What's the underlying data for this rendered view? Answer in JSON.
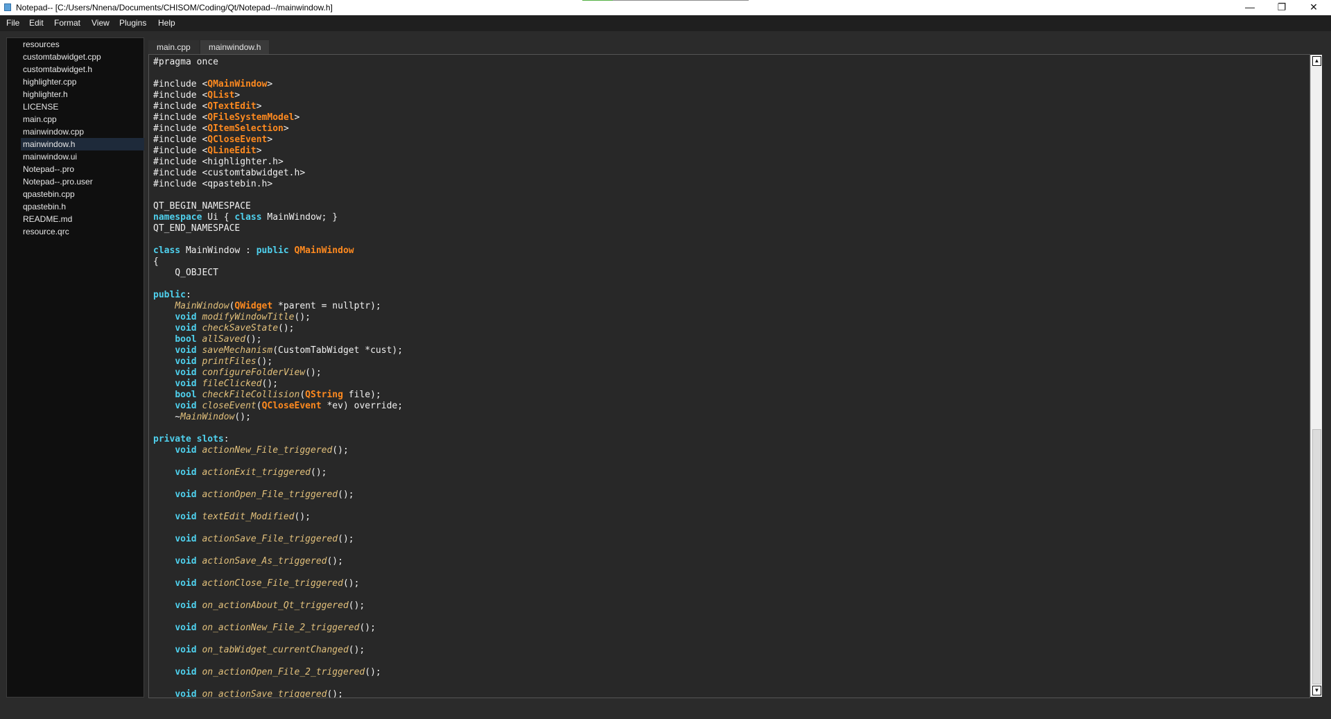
{
  "window": {
    "title": "Notepad-- [C:/Users/Nnena/Documents/CHISOM/Coding/Qt/Notepad--/mainwindow.h]",
    "minimize_label": "—",
    "restore_label": "❐",
    "close_label": "✕"
  },
  "menu": [
    "File",
    "Edit",
    "Format",
    "View",
    "Plugins",
    "Help"
  ],
  "files": [
    "resources",
    "customtabwidget.cpp",
    "customtabwidget.h",
    "highlighter.cpp",
    "highlighter.h",
    "LICENSE",
    "main.cpp",
    "mainwindow.cpp",
    "mainwindow.h",
    "mainwindow.ui",
    "Notepad--.pro",
    "Notepad--.pro.user",
    "qpastebin.cpp",
    "qpastebin.h",
    "README.md",
    "resource.qrc"
  ],
  "selected_file": "mainwindow.h",
  "tabs": [
    "main.cpp",
    "mainwindow.h"
  ],
  "active_tab": "mainwindow.h",
  "colors": {
    "keyword": "#4fd1ee",
    "qt_class": "#ff8a1f",
    "function": "#e2c07b",
    "text": "#f0f0f0",
    "editor_bg": "#282828",
    "sidebar_bg": "#0f0f0f",
    "menubar_bg": "#1f1f1f"
  },
  "code_lines": [
    [
      [
        "p",
        "#pragma once"
      ]
    ],
    [],
    [
      [
        "p",
        "#include <"
      ],
      [
        "q",
        "QMainWindow"
      ],
      [
        "p",
        ">"
      ]
    ],
    [
      [
        "p",
        "#include <"
      ],
      [
        "q",
        "QList"
      ],
      [
        "p",
        ">"
      ]
    ],
    [
      [
        "p",
        "#include <"
      ],
      [
        "q",
        "QTextEdit"
      ],
      [
        "p",
        ">"
      ]
    ],
    [
      [
        "p",
        "#include <"
      ],
      [
        "q",
        "QFileSystemModel"
      ],
      [
        "p",
        ">"
      ]
    ],
    [
      [
        "p",
        "#include <"
      ],
      [
        "q",
        "QItemSelection"
      ],
      [
        "p",
        ">"
      ]
    ],
    [
      [
        "p",
        "#include <"
      ],
      [
        "q",
        "QCloseEvent"
      ],
      [
        "p",
        ">"
      ]
    ],
    [
      [
        "p",
        "#include <"
      ],
      [
        "q",
        "QLineEdit"
      ],
      [
        "p",
        ">"
      ]
    ],
    [
      [
        "p",
        "#include <highlighter.h>"
      ]
    ],
    [
      [
        "p",
        "#include <customtabwidget.h>"
      ]
    ],
    [
      [
        "p",
        "#include <qpastebin.h>"
      ]
    ],
    [],
    [
      [
        "p",
        "QT_BEGIN_NAMESPACE"
      ]
    ],
    [
      [
        "k",
        "namespace"
      ],
      [
        "p",
        " Ui { "
      ],
      [
        "k",
        "class"
      ],
      [
        "p",
        " MainWindow; }"
      ]
    ],
    [
      [
        "p",
        "QT_END_NAMESPACE"
      ]
    ],
    [],
    [
      [
        "k",
        "class"
      ],
      [
        "p",
        " MainWindow : "
      ],
      [
        "k",
        "public"
      ],
      [
        "p",
        " "
      ],
      [
        "q",
        "QMainWindow"
      ]
    ],
    [
      [
        "p",
        "{"
      ]
    ],
    [
      [
        "p",
        "    Q_OBJECT"
      ]
    ],
    [],
    [
      [
        "k",
        "public"
      ],
      [
        "p",
        ":"
      ]
    ],
    [
      [
        "p",
        "    "
      ],
      [
        "f",
        "MainWindow"
      ],
      [
        "p",
        "("
      ],
      [
        "q",
        "QWidget"
      ],
      [
        "p",
        " *parent = nullptr);"
      ]
    ],
    [
      [
        "p",
        "    "
      ],
      [
        "k",
        "void"
      ],
      [
        "p",
        " "
      ],
      [
        "f",
        "modifyWindowTitle"
      ],
      [
        "p",
        "();"
      ]
    ],
    [
      [
        "p",
        "    "
      ],
      [
        "k",
        "void"
      ],
      [
        "p",
        " "
      ],
      [
        "f",
        "checkSaveState"
      ],
      [
        "p",
        "();"
      ]
    ],
    [
      [
        "p",
        "    "
      ],
      [
        "k",
        "bool"
      ],
      [
        "p",
        " "
      ],
      [
        "f",
        "allSaved"
      ],
      [
        "p",
        "();"
      ]
    ],
    [
      [
        "p",
        "    "
      ],
      [
        "k",
        "void"
      ],
      [
        "p",
        " "
      ],
      [
        "f",
        "saveMechanism"
      ],
      [
        "p",
        "(CustomTabWidget *cust);"
      ]
    ],
    [
      [
        "p",
        "    "
      ],
      [
        "k",
        "void"
      ],
      [
        "p",
        " "
      ],
      [
        "f",
        "printFiles"
      ],
      [
        "p",
        "();"
      ]
    ],
    [
      [
        "p",
        "    "
      ],
      [
        "k",
        "void"
      ],
      [
        "p",
        " "
      ],
      [
        "f",
        "configureFolderView"
      ],
      [
        "p",
        "();"
      ]
    ],
    [
      [
        "p",
        "    "
      ],
      [
        "k",
        "void"
      ],
      [
        "p",
        " "
      ],
      [
        "f",
        "fileClicked"
      ],
      [
        "p",
        "();"
      ]
    ],
    [
      [
        "p",
        "    "
      ],
      [
        "k",
        "bool"
      ],
      [
        "p",
        " "
      ],
      [
        "f",
        "checkFileCollision"
      ],
      [
        "p",
        "("
      ],
      [
        "q",
        "QString"
      ],
      [
        "p",
        " file);"
      ]
    ],
    [
      [
        "p",
        "    "
      ],
      [
        "k",
        "void"
      ],
      [
        "p",
        " "
      ],
      [
        "f",
        "closeEvent"
      ],
      [
        "p",
        "("
      ],
      [
        "q",
        "QCloseEvent"
      ],
      [
        "p",
        " *ev) override;"
      ]
    ],
    [
      [
        "p",
        "    ~"
      ],
      [
        "f",
        "MainWindow"
      ],
      [
        "p",
        "();"
      ]
    ],
    [],
    [
      [
        "k",
        "private slots"
      ],
      [
        "p",
        ":"
      ]
    ],
    [
      [
        "p",
        "    "
      ],
      [
        "k",
        "void"
      ],
      [
        "p",
        " "
      ],
      [
        "f",
        "actionNew_File_triggered"
      ],
      [
        "p",
        "();"
      ]
    ],
    [],
    [
      [
        "p",
        "    "
      ],
      [
        "k",
        "void"
      ],
      [
        "p",
        " "
      ],
      [
        "f",
        "actionExit_triggered"
      ],
      [
        "p",
        "();"
      ]
    ],
    [],
    [
      [
        "p",
        "    "
      ],
      [
        "k",
        "void"
      ],
      [
        "p",
        " "
      ],
      [
        "f",
        "actionOpen_File_triggered"
      ],
      [
        "p",
        "();"
      ]
    ],
    [],
    [
      [
        "p",
        "    "
      ],
      [
        "k",
        "void"
      ],
      [
        "p",
        " "
      ],
      [
        "f",
        "textEdit_Modified"
      ],
      [
        "p",
        "();"
      ]
    ],
    [],
    [
      [
        "p",
        "    "
      ],
      [
        "k",
        "void"
      ],
      [
        "p",
        " "
      ],
      [
        "f",
        "actionSave_File_triggered"
      ],
      [
        "p",
        "();"
      ]
    ],
    [],
    [
      [
        "p",
        "    "
      ],
      [
        "k",
        "void"
      ],
      [
        "p",
        " "
      ],
      [
        "f",
        "actionSave_As_triggered"
      ],
      [
        "p",
        "();"
      ]
    ],
    [],
    [
      [
        "p",
        "    "
      ],
      [
        "k",
        "void"
      ],
      [
        "p",
        " "
      ],
      [
        "f",
        "actionClose_File_triggered"
      ],
      [
        "p",
        "();"
      ]
    ],
    [],
    [
      [
        "p",
        "    "
      ],
      [
        "k",
        "void"
      ],
      [
        "p",
        " "
      ],
      [
        "f",
        "on_actionAbout_Qt_triggered"
      ],
      [
        "p",
        "();"
      ]
    ],
    [],
    [
      [
        "p",
        "    "
      ],
      [
        "k",
        "void"
      ],
      [
        "p",
        " "
      ],
      [
        "f",
        "on_actionNew_File_2_triggered"
      ],
      [
        "p",
        "();"
      ]
    ],
    [],
    [
      [
        "p",
        "    "
      ],
      [
        "k",
        "void"
      ],
      [
        "p",
        " "
      ],
      [
        "f",
        "on_tabWidget_currentChanged"
      ],
      [
        "p",
        "();"
      ]
    ],
    [],
    [
      [
        "p",
        "    "
      ],
      [
        "k",
        "void"
      ],
      [
        "p",
        " "
      ],
      [
        "f",
        "on_actionOpen_File_2_triggered"
      ],
      [
        "p",
        "();"
      ]
    ],
    [],
    [
      [
        "p",
        "    "
      ],
      [
        "k",
        "void"
      ],
      [
        "p",
        " "
      ],
      [
        "f",
        "on_actionSave_triggered"
      ],
      [
        "p",
        "();"
      ]
    ]
  ]
}
